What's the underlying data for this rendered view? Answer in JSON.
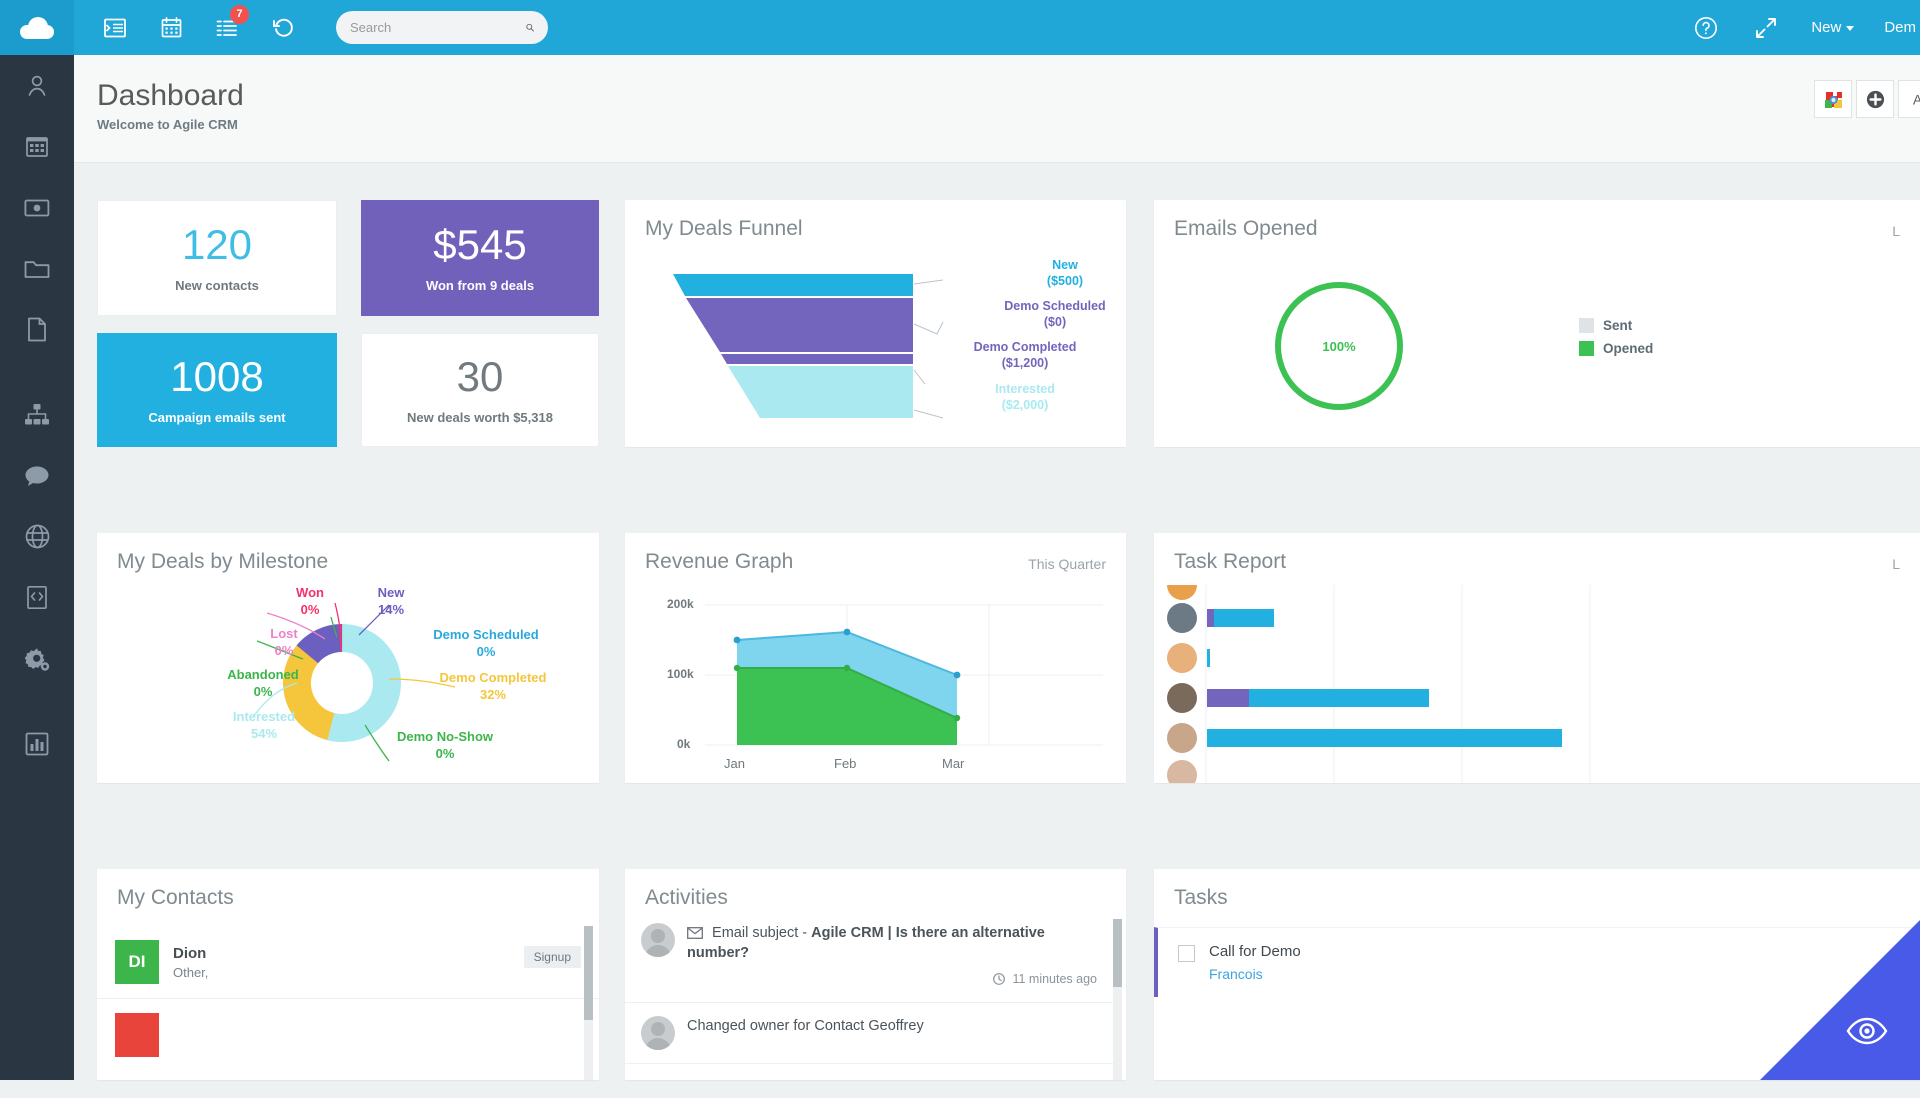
{
  "topbar": {
    "brand_icon": "cloud-logo",
    "icons": [
      {
        "name": "list-indent-icon",
        "badge": null
      },
      {
        "name": "calendar-icon",
        "badge": null
      },
      {
        "name": "tasks-list-icon",
        "badge": "7"
      },
      {
        "name": "history-icon",
        "badge": null
      }
    ],
    "search": {
      "value": "",
      "placeholder": "Search"
    },
    "help_icon": "help-circle-icon",
    "expand_icon": "expand-arrows-icon",
    "new_label": "New",
    "user_label": "Dem"
  },
  "sidebar": {
    "items": [
      {
        "name": "sidebar-item-contacts",
        "icon": "person-icon"
      },
      {
        "name": "sidebar-item-calendar",
        "icon": "calendar-grid-icon"
      },
      {
        "name": "sidebar-item-deals",
        "icon": "money-icon"
      },
      {
        "name": "sidebar-item-cases",
        "icon": "folder-icon"
      },
      {
        "name": "sidebar-item-documents",
        "icon": "document-icon"
      },
      {
        "name": "sidebar-item-campaigns",
        "icon": "sitemap-icon"
      },
      {
        "name": "sidebar-item-social",
        "icon": "chat-icon"
      },
      {
        "name": "sidebar-item-web",
        "icon": "globe-icon"
      },
      {
        "name": "sidebar-item-forms",
        "icon": "form-icon"
      },
      {
        "name": "sidebar-item-settings",
        "icon": "gears-icon"
      },
      {
        "name": "sidebar-item-reports",
        "icon": "bar-chart-icon"
      }
    ]
  },
  "header": {
    "title": "Dashboard",
    "subtitle": "Welcome to Agile CRM",
    "actions": [
      {
        "name": "chrome-extension-button",
        "icon": "chrome-puzzle-icon"
      },
      {
        "name": "add-widget-button",
        "icon": "plus-circle-icon"
      },
      {
        "name": "third-action-button",
        "icon": "letter-a-icon"
      }
    ]
  },
  "stats": [
    {
      "name": "new-contacts-tile",
      "value": "120",
      "label": "New contacts",
      "style": "white"
    },
    {
      "name": "won-deals-tile",
      "value": "$545",
      "label": "Won from 9 deals",
      "style": "purple"
    },
    {
      "name": "campaign-emails-tile",
      "value": "1008",
      "label": "Campaign emails sent",
      "style": "blue"
    },
    {
      "name": "new-deals-tile",
      "value": "30",
      "label": "New deals worth $5,318",
      "style": "grey"
    }
  ],
  "funnel": {
    "title": "My Deals Funnel",
    "chart_data": {
      "type": "funnel",
      "title": "My Deals Funnel",
      "stages": [
        {
          "label": "New",
          "amount": "($500)",
          "value": 500,
          "color": "#22b0e0"
        },
        {
          "label": "Demo Scheduled",
          "amount": "($0)",
          "value": 0,
          "color": "#7365bd"
        },
        {
          "label": "Demo Completed",
          "amount": "($1,200)",
          "value": 1200,
          "color": "#7365bd"
        },
        {
          "label": "Interested",
          "amount": "($2,000)",
          "value": 2000,
          "color": "#a9e9ef"
        }
      ]
    }
  },
  "emails_opened": {
    "title": "Emails Opened",
    "title_right": "L",
    "chart_data": {
      "type": "donut",
      "title": "Emails Opened",
      "center_label": "100%",
      "ring_color": "#3cc153",
      "legend": [
        {
          "label": "Sent",
          "color": "#dfe3e5"
        },
        {
          "label": "Opened",
          "color": "#3cc153"
        }
      ],
      "values": [
        100
      ]
    }
  },
  "milestone": {
    "title": "My Deals by Milestone",
    "chart_data": {
      "type": "donut",
      "title": "My Deals by Milestone",
      "labels": [
        "Won",
        "New",
        "Demo Scheduled",
        "Demo Completed",
        "Demo No-Show",
        "Interested",
        "Abandoned",
        "Lost"
      ],
      "values": [
        0,
        14,
        0,
        32,
        0,
        54,
        0,
        0
      ],
      "percent_labels": [
        "0%",
        "14%",
        "0%",
        "32%",
        "0%",
        "54%",
        "0%",
        "0%"
      ],
      "colors": [
        "#f5316a",
        "#6b5fc0",
        "#29a8e0",
        "#f5c63c",
        "#3cb54a",
        "#a9e9ef",
        "#3cb54a",
        "#ef7fc9"
      ]
    }
  },
  "revenue": {
    "title": "Revenue Graph",
    "period": "This Quarter",
    "chart_data": {
      "type": "area",
      "title": "Revenue Graph",
      "x": [
        "Jan",
        "Feb",
        "Mar"
      ],
      "yticks": [
        "0k",
        "100k",
        "200k"
      ],
      "ylim": [
        0,
        200000
      ],
      "series": [
        {
          "name": "upper",
          "color": "#7fd4ee",
          "values": [
            150000,
            165000,
            75000
          ]
        },
        {
          "name": "lower",
          "color": "#3cc153",
          "values": [
            110000,
            110000,
            35000
          ]
        }
      ]
    }
  },
  "task_report": {
    "title": "Task Report",
    "title_right": "L",
    "chart_data": {
      "type": "bar",
      "title": "Task Report",
      "orientation": "horizontal",
      "rows": [
        {
          "purple": 0,
          "blue": 0
        },
        {
          "purple": 0,
          "blue": 60
        },
        {
          "purple": 0,
          "blue": 2
        },
        {
          "purple": 42,
          "blue": 175
        },
        {
          "purple": 0,
          "blue": 350
        },
        {
          "purple": 0,
          "blue": 0
        }
      ],
      "colors": {
        "purple": "#7365bd",
        "blue": "#22b0e0"
      }
    }
  },
  "contacts": {
    "title": "My Contacts",
    "rows": [
      {
        "initials": "DI",
        "color": "#3cb54a",
        "name": "Dion",
        "sub": "Other,",
        "tag": "Signup"
      }
    ]
  },
  "activities": {
    "title": "Activities",
    "rows": [
      {
        "icon": "envelope-icon",
        "text_prefix": "Email subject - ",
        "text": "Agile CRM | Is there an alternative number?",
        "time_icon": "clock-icon",
        "time": "11 minutes ago"
      },
      {
        "icon": null,
        "text_prefix": "",
        "text": "Changed owner for Contact Geoffrey",
        "time_icon": null,
        "time": ""
      }
    ]
  },
  "tasks": {
    "title": "Tasks",
    "rows": [
      {
        "name": "Call for Demo",
        "owner": "Francois"
      }
    ]
  },
  "help_widget": {
    "icon": "eye-search-icon",
    "color": "#4a5ae8"
  }
}
